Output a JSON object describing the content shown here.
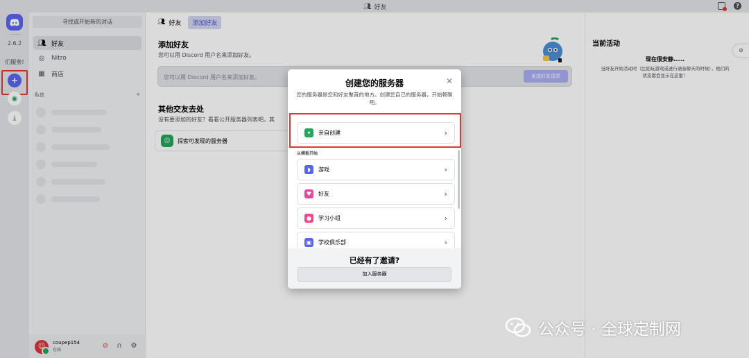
{
  "titlebar": {
    "title": "好友"
  },
  "rail": {
    "version": "2.6.2",
    "server_label": "们服务!"
  },
  "sidebar": {
    "search_placeholder": "寻找或开始新的对话",
    "items": [
      {
        "label": "好友",
        "icon": "friends-icon"
      },
      {
        "label": "Nitro",
        "icon": "nitro-icon"
      },
      {
        "label": "商店",
        "icon": "shop-icon"
      }
    ],
    "dm_header": "私信",
    "dm_add": "+"
  },
  "user": {
    "name": "coupep154",
    "status": "在线"
  },
  "main": {
    "tabs": {
      "friends": "好友",
      "add_friend": "添加好友"
    },
    "add_title": "添加好友",
    "add_subtitle": "您可以用 Discord 用户名来添加好友。",
    "add_placeholder": "您可以用 Discord 用户名来添加好友。",
    "send_button": "发送好友请求",
    "other_title": "其他交友去处",
    "other_subtitle": "没有要添加的好友？看看公开服务器列表吧。其",
    "explore_label": "探索可发现的服务器"
  },
  "activity": {
    "title": "当前活动",
    "subtitle": "现在很安静……",
    "description": "当好友开始活动时（比如玩游戏或进行语音聊天的时候），他们的状态都会显示在这里！"
  },
  "modal": {
    "title": "创建您的服务器",
    "subtitle": "您的服务器是您和好友聚首的地方。创建您自己的服务器，开始畅聊吧。",
    "create_own": "亲自创建",
    "template_label": "从模板开始",
    "templates": [
      {
        "label": "游戏",
        "icon": "gamepad-icon",
        "color": "#5865f2"
      },
      {
        "label": "好友",
        "icon": "heart-icon",
        "color": "#eb459e"
      },
      {
        "label": "学习小组",
        "icon": "apple-icon",
        "color": "#f0478c"
      },
      {
        "label": "学校俱乐部",
        "icon": "school-icon",
        "color": "#5865f2"
      }
    ],
    "footer_title": "已经有了邀请?",
    "join_button": "加入服务器"
  },
  "watermark": {
    "text": "公众号 · 全球定制网"
  },
  "colors": {
    "blurple": "#5865f2",
    "highlight_red": "#e5352f",
    "green": "#23a55a"
  }
}
